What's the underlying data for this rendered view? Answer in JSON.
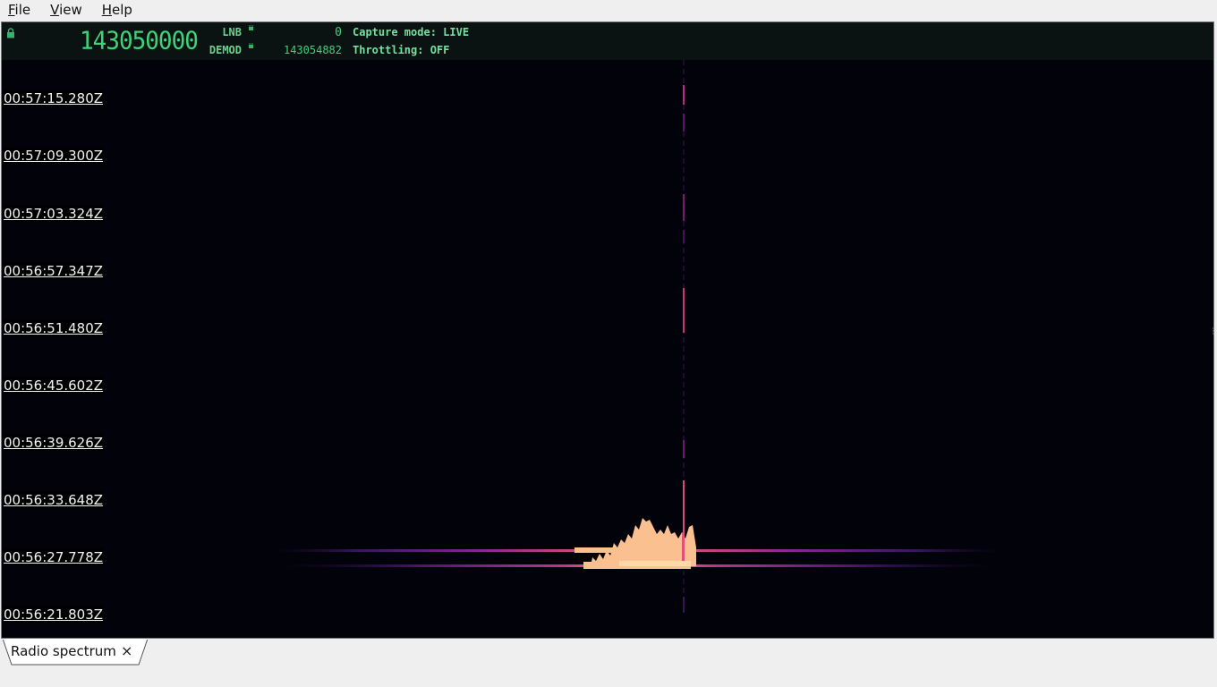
{
  "menu": {
    "file": "File",
    "view": "View",
    "help": "Help"
  },
  "header": {
    "main_frequency": "143050000",
    "lnb_label": "LNB",
    "lnb_value": "0",
    "demod_label": "DEMOD",
    "demod_value": "143054882",
    "capture_mode": "Capture mode: LIVE",
    "throttling": "Throttling: OFF",
    "accent_color": "#3fd27a",
    "icons": [
      "lock-icon"
    ]
  },
  "waterfall": {
    "colormap": "magma",
    "background_color": "#02020a",
    "timestamps": [
      "00:57:15.280Z",
      "00:57:09.300Z",
      "00:57:03.324Z",
      "00:56:57.347Z",
      "00:56:51.480Z",
      "00:56:45.602Z",
      "00:56:39.626Z",
      "00:56:33.648Z",
      "00:56:27.778Z",
      "00:56:21.803Z"
    ]
  },
  "tabs": [
    {
      "label": "Radio spectrum",
      "close_icon": "×"
    }
  ]
}
